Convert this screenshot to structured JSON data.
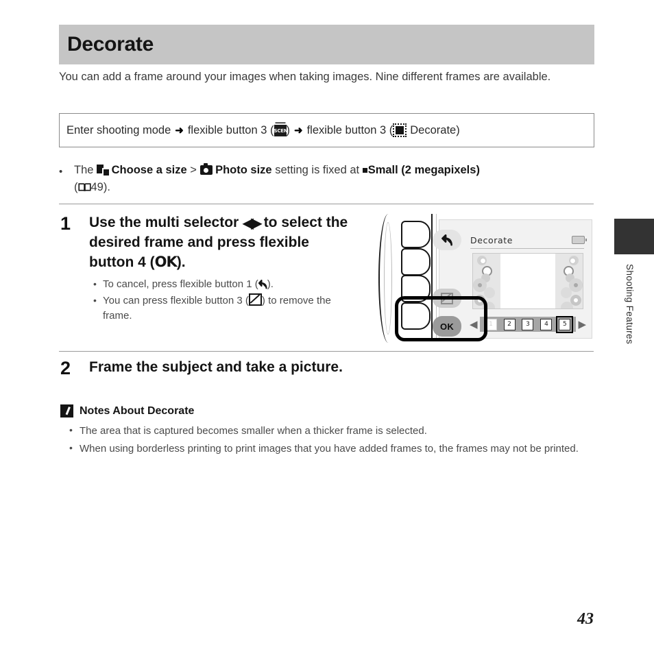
{
  "header": {
    "title": "Decorate"
  },
  "intro": "You can add a frame around your images when taking images. Nine different frames are available.",
  "nav_box": {
    "part1": "Enter shooting mode",
    "part2": "flexible button 3 (",
    "part3": ")",
    "part4": "flexible button 3 (",
    "part5": "Decorate)",
    "arrow": "➜",
    "scene_icon_label": "SCENE"
  },
  "fixed_note": {
    "lead": "The",
    "choose_size": "Choose a size",
    "gt": ">",
    "photo_size": "Photo size",
    "mid": "setting is fixed at",
    "value": "Small (2 megapixels)",
    "ref_open": "(",
    "ref_page": "49).",
    "bullet": "•"
  },
  "steps": [
    {
      "number": "1",
      "heading_a": "Use the multi selector",
      "heading_arrows": "◀▶",
      "heading_b": "to select the desired frame and press flexible button 4 (",
      "heading_ok": "OK",
      "heading_c": ").",
      "bullets": [
        {
          "a": "To cancel, press flexible button 1 (",
          "b": ")."
        },
        {
          "a": "You can press flexible button 3 (",
          "b": ") to remove the frame."
        }
      ]
    },
    {
      "number": "2",
      "heading_a": "Frame the subject and take a picture."
    }
  ],
  "notes": {
    "title": "Notes About Decorate",
    "items": [
      "The area that is captured becomes smaller when a thicker frame is selected.",
      "When using borderless printing to print images that you have added frames to, the frames may not be printed."
    ]
  },
  "camera": {
    "lcd_title": "Decorate",
    "ok_label": "OK",
    "left_arrow": "◀",
    "right_arrow": "▶",
    "frames": [
      {
        "label": "1",
        "state": "faded"
      },
      {
        "label": "2",
        "state": "normal"
      },
      {
        "label": "3",
        "state": "normal"
      },
      {
        "label": "4",
        "state": "normal"
      },
      {
        "label": "5",
        "state": "current"
      }
    ]
  },
  "sidebar": {
    "section_label": "Shooting Features"
  },
  "page_number": "43",
  "colors": {
    "header_bg": "#c5c5c5",
    "tab_dark": "#333333",
    "lcd_bg": "#f2f2f2",
    "selector_track": "#a6a6a6"
  }
}
